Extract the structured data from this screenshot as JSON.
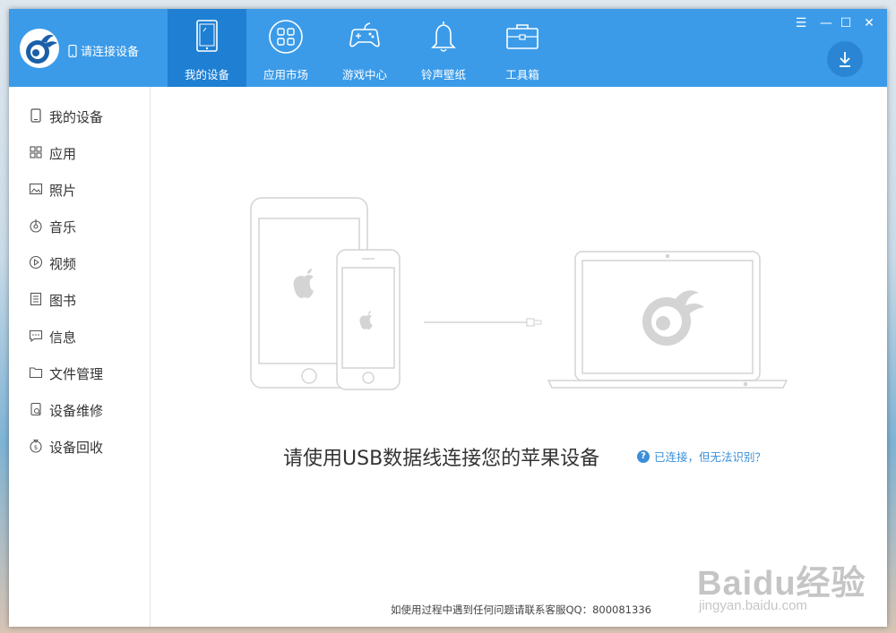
{
  "app": {
    "connect_label": "请连接设备"
  },
  "tabs": [
    {
      "label": "我的设备",
      "icon": "tablet-icon",
      "active": true
    },
    {
      "label": "应用市场",
      "icon": "apps-grid-icon",
      "active": false
    },
    {
      "label": "游戏中心",
      "icon": "gamepad-icon",
      "active": false
    },
    {
      "label": "铃声壁纸",
      "icon": "bell-icon",
      "active": false
    },
    {
      "label": "工具箱",
      "icon": "toolbox-icon",
      "active": false
    }
  ],
  "window_controls": {
    "menu": "☰",
    "minimize": "—",
    "maximize": "☐",
    "close": "✕"
  },
  "download_icon": "↓",
  "sidebar": {
    "items": [
      {
        "label": "我的设备",
        "icon": "device-icon"
      },
      {
        "label": "应用",
        "icon": "apps-icon"
      },
      {
        "label": "照片",
        "icon": "photo-icon"
      },
      {
        "label": "音乐",
        "icon": "music-icon"
      },
      {
        "label": "视频",
        "icon": "video-icon"
      },
      {
        "label": "图书",
        "icon": "book-icon"
      },
      {
        "label": "信息",
        "icon": "message-icon"
      },
      {
        "label": "文件管理",
        "icon": "folder-icon"
      },
      {
        "label": "设备维修",
        "icon": "repair-icon"
      },
      {
        "label": "设备回收",
        "icon": "recycle-icon"
      }
    ]
  },
  "main": {
    "headline": "请使用USB数据线连接您的苹果设备",
    "help_link": "已连接，但无法识别？",
    "help_icon": "?",
    "footer": "如使用过程中遇到任何问题请联系客服QQ：800081336"
  },
  "watermark": {
    "big": "Baidu经验",
    "small": "jingyan.baidu.com"
  },
  "colors": {
    "topbar": "#3b9be9",
    "active_tab": "#1e7fd3",
    "link": "#3b8fd8"
  }
}
